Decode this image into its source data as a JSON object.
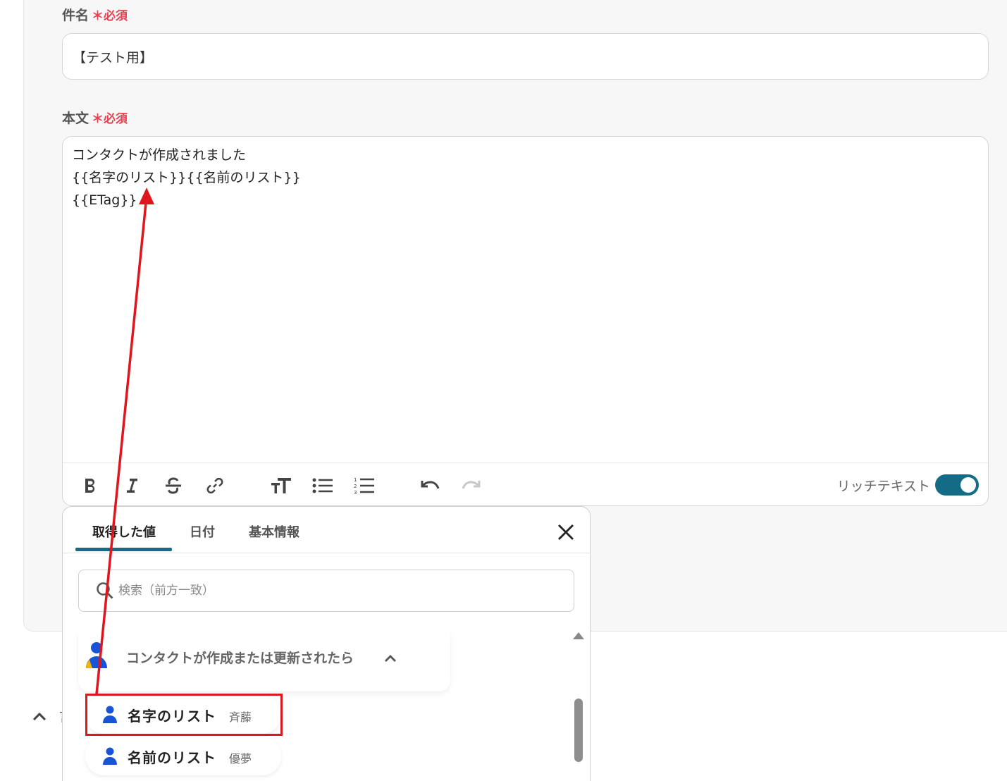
{
  "subject": {
    "label": "件名",
    "required_mark": "＊必須",
    "value": "【テスト用】"
  },
  "body": {
    "label": "本文",
    "required_mark": "＊必須",
    "lines": [
      "コンタクトが作成されました",
      "{{名字のリスト}}{{名前のリスト}}",
      "{{ETag}}"
    ]
  },
  "toolbar": {
    "icons": [
      "bold-icon",
      "italic-icon",
      "strikethrough-icon",
      "link-icon",
      "text-size-icon",
      "bullet-list-icon",
      "numbered-list-icon",
      "undo-icon",
      "redo-icon"
    ],
    "rich_text_label": "リッチテキスト",
    "rich_text_enabled": true,
    "accent_color": "#136b85"
  },
  "picker": {
    "tabs": [
      {
        "label": "取得した値",
        "active": true
      },
      {
        "label": "日付",
        "active": false
      },
      {
        "label": "基本情報",
        "active": false
      }
    ],
    "search_placeholder": "検索（前方一致）",
    "group_label": "コンタクトが作成または更新されたら",
    "items": [
      {
        "name": "名字のリスト",
        "value": "斉藤",
        "highlighted": true
      },
      {
        "name": "名前のリスト",
        "value": "優夢",
        "highlighted": false
      }
    ]
  },
  "bottom": {
    "partial_text": "言"
  },
  "annotation": {
    "color": "#e0161f"
  }
}
